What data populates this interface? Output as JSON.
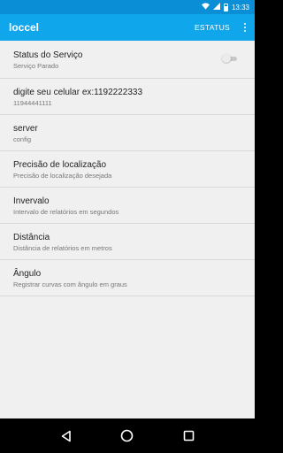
{
  "status_bar": {
    "time": "13:33",
    "icons": [
      "wifi-icon",
      "signal-icon",
      "battery-icon"
    ]
  },
  "app_bar": {
    "title": "loccel",
    "action_label": "ESTATUS",
    "overflow_icon": "more-vert-icon",
    "color": "#10a6ec"
  },
  "preferences": [
    {
      "title": "Status do Serviço",
      "summary": "Serviço Parado",
      "switch_on": false
    },
    {
      "title": "digite seu celular ex:1192222333",
      "summary": "11944441111"
    },
    {
      "title": "server",
      "summary": "config"
    },
    {
      "title": "Precisão de localização",
      "summary": "Precisão de localização desejada"
    },
    {
      "title": "Invervalo",
      "summary": "Intervalo de relatórios em segundos"
    },
    {
      "title": "Distância",
      "summary": "Distância de relatórios em metros"
    },
    {
      "title": "Ângulo",
      "summary": "Registrar curvas com ângulo em graus"
    }
  ],
  "nav_bar": {
    "icons": [
      "back-icon",
      "home-icon",
      "recents-icon"
    ]
  }
}
